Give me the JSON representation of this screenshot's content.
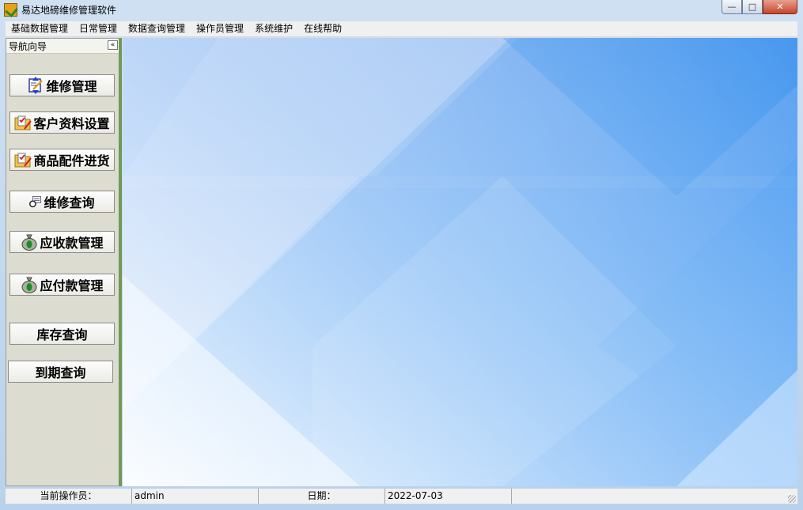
{
  "window": {
    "title": "易达地磅维修管理软件",
    "controls": {
      "minimize": "—",
      "maximize": "□",
      "close": "✕"
    }
  },
  "menu": [
    {
      "label": "基础数据管理"
    },
    {
      "label": "日常管理"
    },
    {
      "label": "数据查询管理"
    },
    {
      "label": "操作员管理"
    },
    {
      "label": "系统维护"
    },
    {
      "label": "在线帮助"
    }
  ],
  "nav": {
    "title": "导航向导",
    "collapse_label": "«",
    "buttons": [
      {
        "label": "维修管理",
        "icon": "repair-icon"
      },
      {
        "label": "客户资料设置",
        "icon": "customer-folder-icon"
      },
      {
        "label": "商品配件进货",
        "icon": "parts-folder-icon"
      },
      {
        "label": "维修查询",
        "icon": "query-icon"
      },
      {
        "label": "应收款管理",
        "icon": "money-bag-icon"
      },
      {
        "label": "应付款管理",
        "icon": "money-bag-icon"
      },
      {
        "label": "库存查询",
        "icon": ""
      },
      {
        "label": "到期查询",
        "icon": ""
      }
    ]
  },
  "status": {
    "operator_label": "当前操作员：",
    "operator_value": "admin",
    "date_label": "日期：",
    "date_value": "2022-07-03"
  },
  "colors": {
    "main_background": "#4c9af0",
    "nav_edge": "#6f9a55",
    "close_button": "#c7452c"
  }
}
